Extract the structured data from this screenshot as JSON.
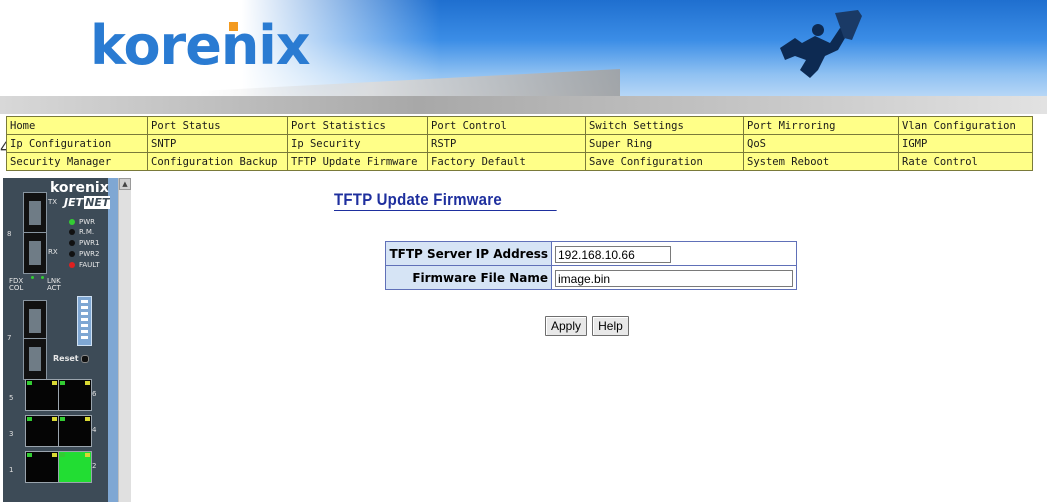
{
  "banner": {
    "logo": "korenix"
  },
  "nav": {
    "rows": [
      [
        "Home",
        "Port Status",
        "Port Statistics",
        "Port Control",
        "Switch Settings",
        "Port Mirroring",
        "Vlan Configuration"
      ],
      [
        "Ip Configuration",
        "SNTP",
        "Ip Security",
        "RSTP",
        "Super Ring",
        "QoS",
        "IGMP"
      ],
      [
        "Security Manager",
        "Configuration Backup",
        "TFTP Update Firmware",
        "Factory Default",
        "Save Configuration",
        "System Reboot",
        "Rate Control"
      ]
    ],
    "stray_glyph": "4"
  },
  "device": {
    "brand": "korenix",
    "jet": "JET",
    "net": "NET",
    "led_labels": [
      "PWR",
      "R.M.",
      "PWR1",
      "PWR2",
      "FAULT"
    ],
    "fdx_col": "FDX\nCOL",
    "lnk_act": "LNK\nACT",
    "reset": "Reset",
    "fiber_tx": "TX",
    "fiber_rx": "RX",
    "fiber_ports": [
      "8",
      "7"
    ],
    "copper_ports": [
      "5",
      "6",
      "3",
      "4",
      "1",
      "2"
    ]
  },
  "main": {
    "title": "TFTP Update Firmware",
    "fields": {
      "server_ip_label": "TFTP Server IP Address",
      "server_ip_value": "192.168.10.66",
      "file_label": "Firmware File Name",
      "file_value": "image.bin"
    },
    "buttons": {
      "apply": "Apply",
      "help": "Help"
    }
  },
  "colors": {
    "nav_bg": "#ffff88",
    "title": "#1e2f9e",
    "label_bg": "#d6e4f5",
    "logo": "#2a7bd2",
    "logo_dot": "#f39a1f"
  }
}
